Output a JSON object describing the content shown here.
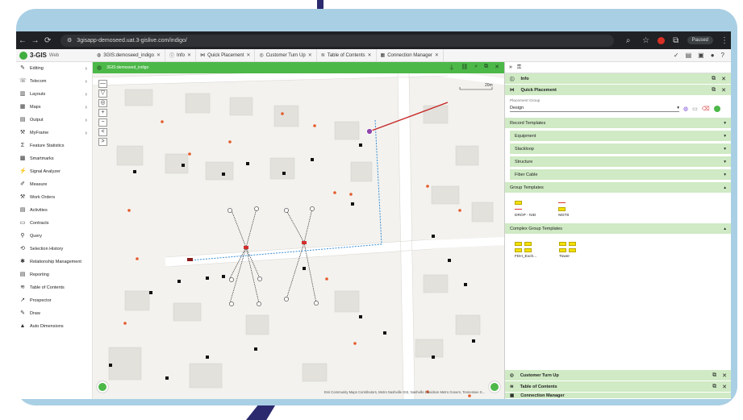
{
  "browser": {
    "url": "3gisapp-demoseed.uat.3-gislive.com/indigo/",
    "profile_status": "Paused"
  },
  "app": {
    "logo_text": "3-GIS",
    "logo_suffix": "Web",
    "tabs": [
      {
        "label": "3GIS:demoseed_indigo"
      },
      {
        "label": "Info"
      },
      {
        "label": "Quick Placement"
      },
      {
        "label": "Customer Turn Up"
      },
      {
        "label": "Table of Contents"
      },
      {
        "label": "Connection Manager"
      }
    ]
  },
  "sidebar": {
    "items": [
      {
        "label": "Editing",
        "icon": "pencil-icon",
        "has_submenu": true
      },
      {
        "label": "Telecom",
        "icon": "phone-icon",
        "has_submenu": true
      },
      {
        "label": "Layouts",
        "icon": "layout-icon",
        "has_submenu": true
      },
      {
        "label": "Maps",
        "icon": "map-icon",
        "has_submenu": true
      },
      {
        "label": "Output",
        "icon": "output-icon",
        "has_submenu": true
      },
      {
        "label": "MyFrame",
        "icon": "wrench-icon",
        "has_submenu": true
      },
      {
        "label": "Feature Statistics",
        "icon": "sigma-icon",
        "has_submenu": false
      },
      {
        "label": "Smartmarks",
        "icon": "smartmark-icon",
        "has_submenu": false
      },
      {
        "label": "Signal Analyzer",
        "icon": "signal-icon",
        "has_submenu": false
      },
      {
        "label": "Measure",
        "icon": "ruler-icon",
        "has_submenu": false
      },
      {
        "label": "Work Orders",
        "icon": "hammer-icon",
        "has_submenu": false
      },
      {
        "label": "Activities",
        "icon": "clipboard-icon",
        "has_submenu": false
      },
      {
        "label": "Contracts",
        "icon": "document-icon",
        "has_submenu": false
      },
      {
        "label": "Query",
        "icon": "query-icon",
        "has_submenu": false
      },
      {
        "label": "Selection History",
        "icon": "history-icon",
        "has_submenu": false
      },
      {
        "label": "Relationship Management",
        "icon": "relationship-icon",
        "has_submenu": false
      },
      {
        "label": "Reporting",
        "icon": "report-icon",
        "has_submenu": false
      },
      {
        "label": "Table of Contents",
        "icon": "toc-icon",
        "has_submenu": false
      },
      {
        "label": "Prospector",
        "icon": "pick-icon",
        "has_submenu": false
      },
      {
        "label": "Draw",
        "icon": "draw-icon",
        "has_submenu": false
      },
      {
        "label": "Auto Dimensions",
        "icon": "dimension-icon",
        "has_submenu": false
      }
    ]
  },
  "map": {
    "title": "3GIS:demoseed_indigo",
    "scale_label": "20m",
    "attribution": "Esri Community Maps Contributors, Metro Nashville GIS, Nashville Davidson Metro Govern, Tennessee S...",
    "accent": "#4cb848"
  },
  "panel": {
    "info_label": "Info",
    "quick_placement_label": "Quick Placement",
    "placement_group_label": "Placement Group",
    "placement_group_value": "Design",
    "record_templates_label": "Record Templates",
    "record_templates": [
      {
        "label": "Equipment"
      },
      {
        "label": "Slackloop"
      },
      {
        "label": "Structure"
      },
      {
        "label": "Fiber Cable"
      }
    ],
    "group_templates_label": "Group Templates",
    "group_templates": [
      {
        "label": "DROP - NID"
      },
      {
        "label": "MST8"
      }
    ],
    "complex_group_templates_label": "Complex Group Templates",
    "complex_group_templates": [
      {
        "label": "FDH_Exch..."
      },
      {
        "label": "Tower"
      }
    ],
    "bottom_groups": [
      {
        "label": "Customer Turn Up"
      },
      {
        "label": "Table of Contents"
      },
      {
        "label": "Connection Manager"
      }
    ],
    "header_color": "#cfeac4"
  }
}
